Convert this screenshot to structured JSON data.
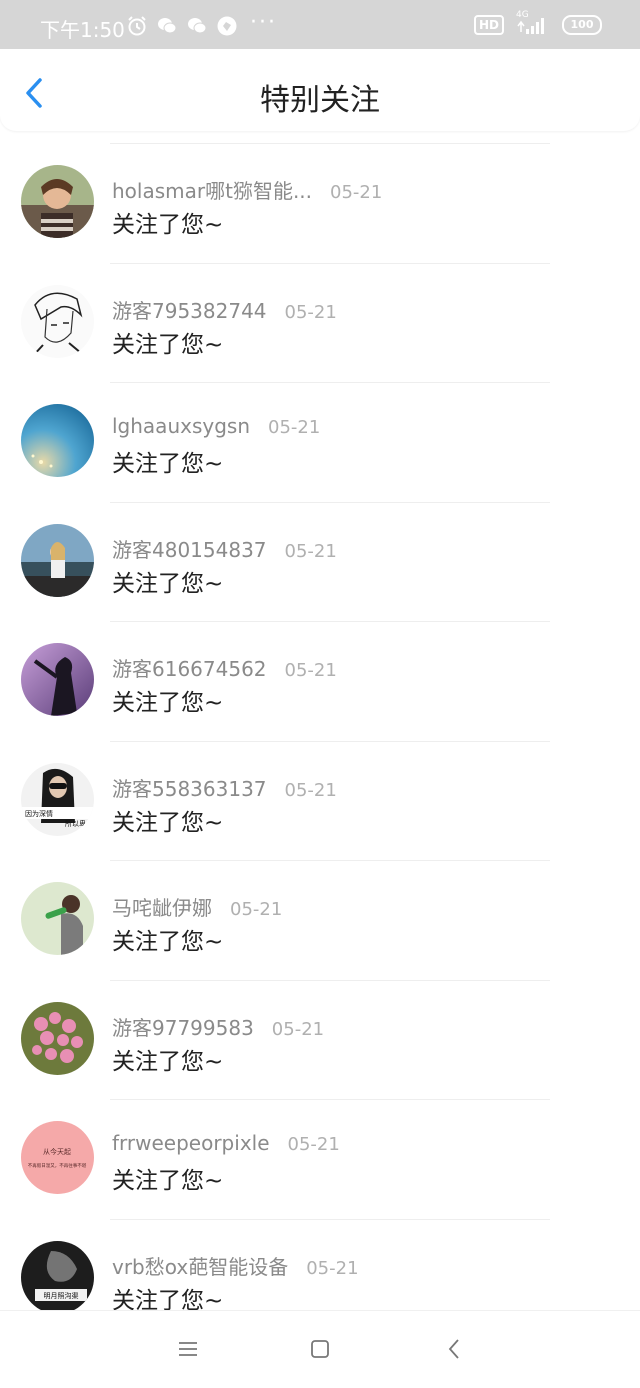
{
  "status_bar": {
    "time": "下午1:50",
    "dots": "···",
    "hd": "HD",
    "network": "4G",
    "battery": "100"
  },
  "header": {
    "title": "特别关注"
  },
  "list": [
    {
      "name": "holasmar哪t猕智能...",
      "date": "05-21",
      "message": "关注了您~"
    },
    {
      "name": "游客795382744",
      "date": "05-21",
      "message": "关注了您~"
    },
    {
      "name": "lghaauxsygsn",
      "date": "05-21",
      "message": "关注了您~"
    },
    {
      "name": "游客480154837",
      "date": "05-21",
      "message": "关注了您~"
    },
    {
      "name": "游客616674562",
      "date": "05-21",
      "message": "关注了您~"
    },
    {
      "name": "游客558363137",
      "date": "05-21",
      "message": "关注了您~"
    },
    {
      "name": "马咤龇伊娜",
      "date": "05-21",
      "message": "关注了您~"
    },
    {
      "name": "游客97799583",
      "date": "05-21",
      "message": "关注了您~"
    },
    {
      "name": "frrweepeorpixle",
      "date": "05-21",
      "message": "关注了您~"
    },
    {
      "name": "vrb愁ox葩智能设备",
      "date": "05-21",
      "message": "关注了您~"
    }
  ],
  "avatar_texts": {
    "row6_left": "因为深情",
    "row6_right": "所以卑",
    "row9_top": "从今天起",
    "row9_bottom": "不再假日温又，不再往事不堪",
    "row10": "明月照沟渠"
  },
  "colors": {
    "accent": "#2a8ff0",
    "status_bar_bg": "#d6d6d6"
  }
}
